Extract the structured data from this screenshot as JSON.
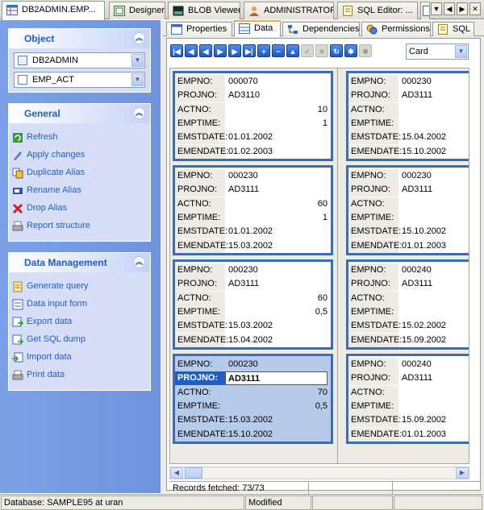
{
  "top_tabs": [
    {
      "label": "DB2ADMIN.EMP...",
      "icon": "table-icon"
    },
    {
      "label": "Designer",
      "icon": "designer-icon"
    },
    {
      "label": "BLOB Viewer",
      "icon": "blob-icon"
    },
    {
      "label": "ADMINISTRATOR",
      "icon": "user-icon"
    },
    {
      "label": "SQL Editor: ...",
      "icon": "sql-editor-icon"
    }
  ],
  "object_group": {
    "title": "Object",
    "database": "DB2ADMIN",
    "table": "EMP_ACT"
  },
  "general_group": {
    "title": "General",
    "items": [
      "Refresh",
      "Apply changes",
      "Duplicate Alias",
      "Rename Alias",
      "Drop Alias",
      "Report structure"
    ]
  },
  "data_group": {
    "title": "Data Management",
    "items": [
      "Generate query",
      "Data input form",
      "Export data",
      "Get SQL dump",
      "Import data",
      "Print data"
    ]
  },
  "sub_tabs": [
    "Properties",
    "Data",
    "Dependencies",
    "Permissions",
    "SQL"
  ],
  "view_mode": "Card",
  "field_labels": [
    "EMPNO:",
    "PROJNO:",
    "ACTNO:",
    "EMPTIME:",
    "EMSTDATE:",
    "EMENDATE:"
  ],
  "cards": [
    {
      "empno": "000070",
      "projno": "AD3110",
      "actno": "10",
      "emptime": "1",
      "emstdate": "01.01.2002",
      "emendate": "01.02.2003"
    },
    {
      "empno": "000230",
      "projno": "AD3111",
      "actno": "",
      "emptime": "",
      "emstdate": "15.04.2002",
      "emendate": "15.10.2002"
    },
    {
      "empno": "000230",
      "projno": "AD3111",
      "actno": "60",
      "emptime": "1",
      "emstdate": "01.01.2002",
      "emendate": "15.03.2002"
    },
    {
      "empno": "000230",
      "projno": "AD3111",
      "actno": "",
      "emptime": "",
      "emstdate": "15.10.2002",
      "emendate": "01.01.2003"
    },
    {
      "empno": "000230",
      "projno": "AD3111",
      "actno": "60",
      "emptime": "0,5",
      "emstdate": "15.03.2002",
      "emendate": "15.04.2002"
    },
    {
      "empno": "000240",
      "projno": "AD3111",
      "actno": "",
      "emptime": "",
      "emstdate": "15.02.2002",
      "emendate": "15.09.2002"
    },
    {
      "empno": "000230",
      "projno": "AD3111",
      "actno": "70",
      "emptime": "0,5",
      "emstdate": "15.03.2002",
      "emendate": "15.10.2002"
    },
    {
      "empno": "000240",
      "projno": "AD3111",
      "actno": "",
      "emptime": "",
      "emstdate": "15.09.2002",
      "emendate": "01.01.2003"
    }
  ],
  "records_fetched": "Records fetched: 73/73",
  "status": {
    "database": "Database: SAMPLE95 at uran",
    "state": "Modified"
  }
}
